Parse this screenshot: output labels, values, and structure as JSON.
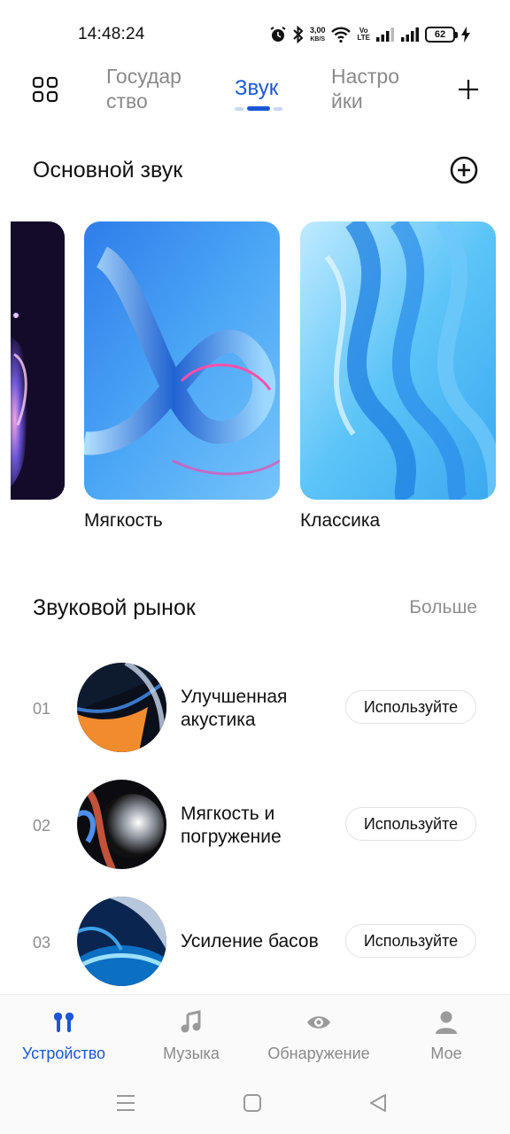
{
  "status_bar": {
    "time": "14:48:24",
    "net_speed": "3,00",
    "net_unit": "KB/S",
    "volte_top": "Vo",
    "volte_bottom": "LTE",
    "battery": "62"
  },
  "top_nav": {
    "tabs": [
      {
        "label_line1": "Государ",
        "label_line2": "ство"
      },
      {
        "label": "Звук"
      },
      {
        "label_line1": "Настро",
        "label_line2": "йки"
      }
    ],
    "active_color": "#1a57d6"
  },
  "basic_sound": {
    "title": "Основной звук",
    "cards": [
      {
        "label": "Мягкость"
      },
      {
        "label": "Классика"
      }
    ]
  },
  "sound_market": {
    "title": "Звуковой рынок",
    "more": "Больше",
    "items": [
      {
        "rank": "01",
        "title": "Улучшенная акустика",
        "button": "Используйте"
      },
      {
        "rank": "02",
        "title": "Мягкость и погружение",
        "button": "Используйте"
      },
      {
        "rank": "03",
        "title": "Усиление басов",
        "button": "Используйте"
      }
    ]
  },
  "bottom_nav": {
    "items": [
      {
        "label": "Устройство",
        "icon": "earbuds-icon",
        "active": true
      },
      {
        "label": "Музыка",
        "icon": "music-note-icon",
        "active": false
      },
      {
        "label": "Обнаружение",
        "icon": "eye-icon",
        "active": false
      },
      {
        "label": "Мое",
        "icon": "person-icon",
        "active": false
      }
    ]
  }
}
